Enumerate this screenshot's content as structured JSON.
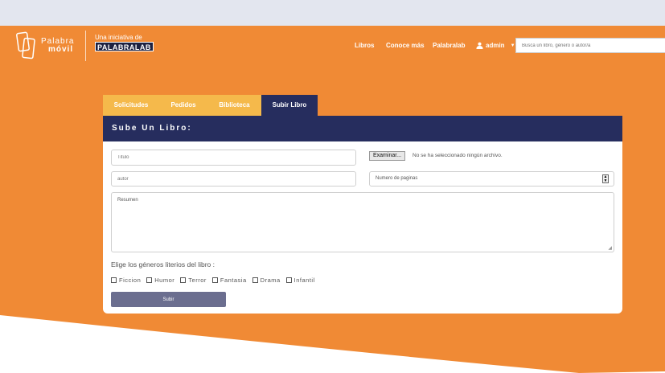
{
  "brand": {
    "name_top": "Palabra",
    "name_bottom": "móvil",
    "initiative_text": "Una iniciativa de",
    "partner_logo": "PALABRALAB"
  },
  "nav": {
    "libros": "Libros",
    "conoce": "Conoce más",
    "palabralab": "Palabralab",
    "admin": "admin"
  },
  "search": {
    "placeholder": "Busca un libro, género o autor/a"
  },
  "tabs": [
    "Solicitudes",
    "Pedidos",
    "Biblioteca",
    "Subir Libro"
  ],
  "form": {
    "header": "Sube Un Libro:",
    "titulo_placeholder": "Titulo",
    "autor_placeholder": "autor",
    "paginas_placeholder": "Numero de paginas",
    "resumen_placeholder": "Resumen",
    "file_button": "Examinar...",
    "file_status": "No se ha seleccionado ningún archivo.",
    "genres_label": "Elige los géneros literios del libro :",
    "genres": [
      "Ficcion",
      "Humor",
      "Terror",
      "Fantasia",
      "Drama",
      "Infantil"
    ],
    "submit": "Subir"
  },
  "colors": {
    "orange": "#f08a35",
    "navy": "#262d5e",
    "tab_yellow": "#f5b94b",
    "submit": "#6b6e8f"
  },
  "icons": [
    "book-logo-icon",
    "user-icon",
    "caret-down-icon",
    "spinner-arrows-icon",
    "resize-grip-icon"
  ]
}
